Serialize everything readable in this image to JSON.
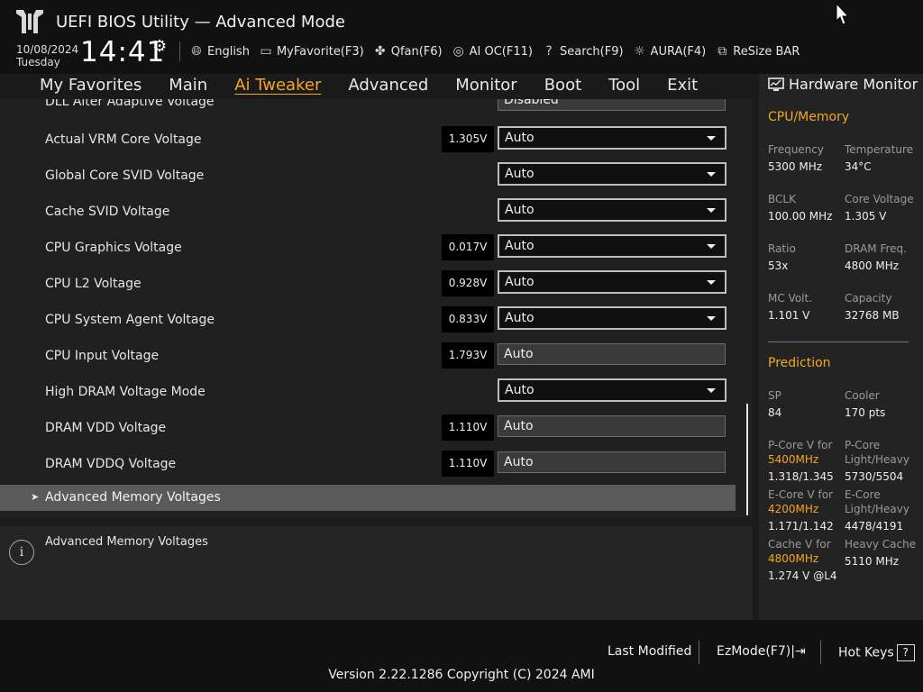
{
  "header": {
    "title": "UEFI BIOS Utility — Advanced Mode",
    "date": "10/08/2024",
    "day": "Tuesday",
    "time": "14:41",
    "toolbar": [
      {
        "label": "English",
        "icon": "globe-icon"
      },
      {
        "label": "MyFavorite(F3)",
        "icon": "favorite-icon"
      },
      {
        "label": "Qfan(F6)",
        "icon": "fan-icon"
      },
      {
        "label": "AI OC(F11)",
        "icon": "ai-chip-icon"
      },
      {
        "label": "Search(F9)",
        "icon": "search-icon"
      },
      {
        "label": "AURA(F4)",
        "icon": "aura-icon"
      },
      {
        "label": "ReSize BAR",
        "icon": "resize-bar-icon"
      }
    ]
  },
  "nav": {
    "tabs": [
      "My Favorites",
      "Main",
      "Ai Tweaker",
      "Advanced",
      "Monitor",
      "Boot",
      "Tool",
      "Exit"
    ],
    "active": "Ai Tweaker"
  },
  "settings": {
    "partial_top": {
      "label": "DLL Alter Adaptive Voltage",
      "value": "Disabled"
    },
    "rows": [
      {
        "label": "Actual VRM Core Voltage",
        "reading": "1.305V",
        "value": "Auto",
        "dropdown": true
      },
      {
        "label": "Global Core SVID Voltage",
        "reading": "",
        "value": "Auto",
        "dropdown": true
      },
      {
        "label": "Cache SVID Voltage",
        "reading": "",
        "value": "Auto",
        "dropdown": true
      },
      {
        "label": "CPU Graphics Voltage",
        "reading": "0.017V",
        "value": "Auto",
        "dropdown": true
      },
      {
        "label": "CPU L2 Voltage",
        "reading": "0.928V",
        "value": "Auto",
        "dropdown": true
      },
      {
        "label": "CPU System Agent Voltage",
        "reading": "0.833V",
        "value": "Auto",
        "dropdown": true
      },
      {
        "label": "CPU Input Voltage",
        "reading": "1.793V",
        "value": "Auto",
        "dropdown": false
      },
      {
        "label": "High DRAM Voltage Mode",
        "reading": "",
        "value": "Auto",
        "dropdown": true
      },
      {
        "label": "DRAM VDD Voltage",
        "reading": "1.110V",
        "value": "Auto",
        "dropdown": false
      },
      {
        "label": "DRAM VDDQ Voltage",
        "reading": "1.110V",
        "value": "Auto",
        "dropdown": false
      }
    ],
    "submenu": "Advanced Memory Voltages"
  },
  "help": {
    "text": "Advanced Memory Voltages"
  },
  "hardware_monitor": {
    "title": "Hardware Monitor",
    "cpu_memory": {
      "title": "CPU/Memory",
      "frequency_label": "Frequency",
      "frequency": "5300 MHz",
      "temperature_label": "Temperature",
      "temperature": "34°C",
      "bclk_label": "BCLK",
      "bclk": "100.00 MHz",
      "core_voltage_label": "Core Voltage",
      "core_voltage": "1.305 V",
      "ratio_label": "Ratio",
      "ratio": "53x",
      "dram_freq_label": "DRAM Freq.",
      "dram_freq": "4800 MHz",
      "mc_volt_label": "MC Volt.",
      "mc_volt": "1.101 V",
      "capacity_label": "Capacity",
      "capacity": "32768 MB"
    },
    "prediction": {
      "title": "Prediction",
      "sp_label": "SP",
      "sp": "84",
      "cooler_label": "Cooler",
      "cooler": "170 pts",
      "pcore_v_label": "P-Core V for",
      "pcore_v_freq": "5400MHz",
      "pcore_v": "1.318/1.345",
      "pcore_lh_label": "P-Core Light/Heavy",
      "pcore_lh": "5730/5504",
      "ecore_v_label": "E-Core V for",
      "ecore_v_freq": "4200MHz",
      "ecore_v": "1.171/1.142",
      "ecore_lh_label": "E-Core Light/Heavy",
      "ecore_lh": "4478/4191",
      "cache_v_label": "Cache V for",
      "cache_v_freq": "4800MHz",
      "cache_v": "1.274 V @L4",
      "heavy_cache_label": "Heavy Cache",
      "heavy_cache": "5110 MHz"
    }
  },
  "footer": {
    "last_modified": "Last Modified",
    "ezmode": "EzMode(F7)|",
    "hot_keys": "Hot Keys",
    "version": "Version 2.22.1286 Copyright (C) 2024 AMI"
  },
  "colors": {
    "accent": "#f5a623",
    "background": "#1b1b1b",
    "selection": "#5a5a5a"
  }
}
